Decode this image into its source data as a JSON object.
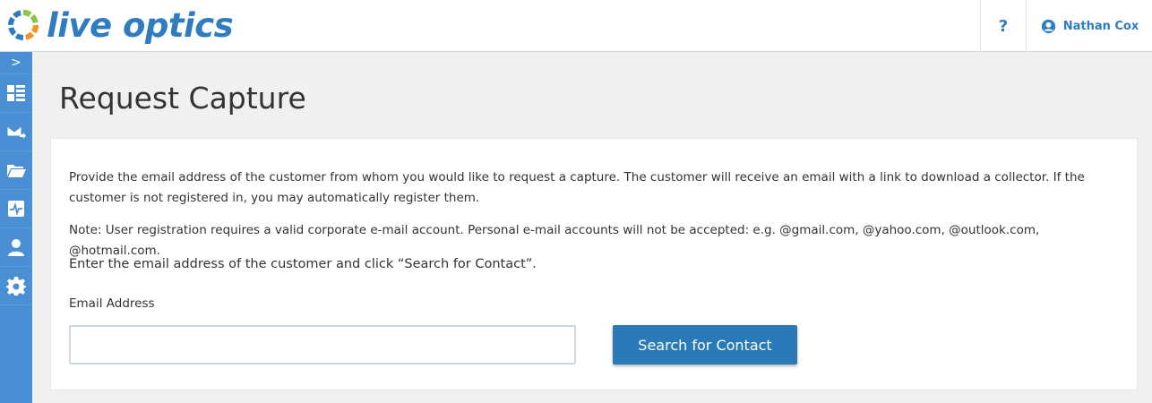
{
  "header": {
    "logo_text": "live optics",
    "help_label": "?",
    "user_name": "Nathan Cox"
  },
  "sidebar": {
    "toggle_label": ">",
    "items": [
      {
        "icon": "dashboard-icon"
      },
      {
        "icon": "mail-send-icon"
      },
      {
        "icon": "folder-icon"
      },
      {
        "icon": "pulse-icon"
      },
      {
        "icon": "user-icon"
      },
      {
        "icon": "gear-icon"
      }
    ]
  },
  "main": {
    "title": "Request Capture",
    "description": "Provide the email address of the customer from whom you would like to request a capture. The customer will receive an email with a link to download a collector. If the customer is not registered in, you may automatically register them.",
    "note": "Note: User registration requires a valid corporate e-mail account. Personal e-mail accounts will not be accepted: e.g. @gmail.com, @yahoo.com, @outlook.com, @hotmail.com.",
    "instruction": "Enter the email address of the customer and click “Search for Contact”.",
    "email_label": "Email Address",
    "email_value": "",
    "email_placeholder": "",
    "search_button": "Search for Contact"
  },
  "colors": {
    "brand": "#2f7cc1",
    "sidebar": "#4a8fd3",
    "button": "#2a7ab8"
  }
}
